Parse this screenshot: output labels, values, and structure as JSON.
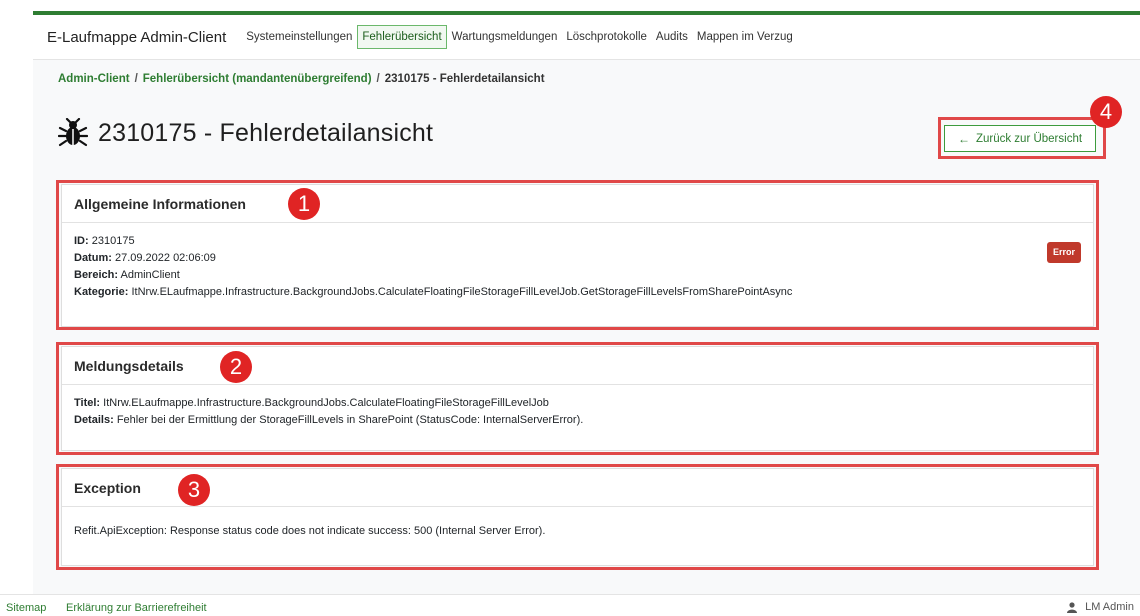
{
  "app": {
    "title": "E-Laufmappe Admin-Client"
  },
  "nav": {
    "items": [
      {
        "label": "Systemeinstellungen",
        "active": false
      },
      {
        "label": "Fehlerübersicht",
        "active": true
      },
      {
        "label": "Wartungsmeldungen",
        "active": false
      },
      {
        "label": "Löschprotokolle",
        "active": false
      },
      {
        "label": "Audits",
        "active": false
      },
      {
        "label": "Mappen im Verzug",
        "active": false
      }
    ]
  },
  "breadcrumb": {
    "items": [
      "Admin-Client",
      "Fehlerübersicht (mandantenübergreifend)",
      "2310175 - Fehlerdetailansicht"
    ],
    "separator": "/"
  },
  "page": {
    "title": "2310175 - Fehlerdetailansicht",
    "title_icon": "bug-icon",
    "back_button": "Zurück zur Übersicht",
    "back_icon": "arrow-left-icon"
  },
  "general": {
    "header": "Allgemeine Informationen",
    "badge": "Error",
    "fields": {
      "id": {
        "label": "ID:",
        "value": "2310175"
      },
      "date": {
        "label": "Datum:",
        "value": "27.09.2022 02:06:09"
      },
      "area": {
        "label": "Bereich:",
        "value": "AdminClient"
      },
      "category": {
        "label": "Kategorie:",
        "value": "ItNrw.ELaufmappe.Infrastructure.BackgroundJobs.CalculateFloatingFileStorageFillLevelJob.GetStorageFillLevelsFromSharePointAsync"
      }
    }
  },
  "message": {
    "header": "Meldungsdetails",
    "fields": {
      "title": {
        "label": "Titel:",
        "value": "ItNrw.ELaufmappe.Infrastructure.BackgroundJobs.CalculateFloatingFileStorageFillLevelJob"
      },
      "details": {
        "label": "Details:",
        "value": "Fehler bei der Ermittlung der StorageFillLevels in SharePoint (StatusCode: InternalServerError)."
      }
    }
  },
  "exception": {
    "header": "Exception",
    "text": "Refit.ApiException: Response status code does not indicate success: 500 (Internal Server Error)."
  },
  "annotations": {
    "markers": [
      "1",
      "2",
      "3",
      "4"
    ]
  },
  "footer": {
    "links": [
      "Sitemap",
      "Erklärung zur Barrierefreiheit"
    ],
    "user": "LM Admin",
    "user_icon": "user-icon"
  },
  "colors": {
    "brand_green": "#2e7d32",
    "annotation_red": "#e02424",
    "error_badge": "#c0392b"
  }
}
